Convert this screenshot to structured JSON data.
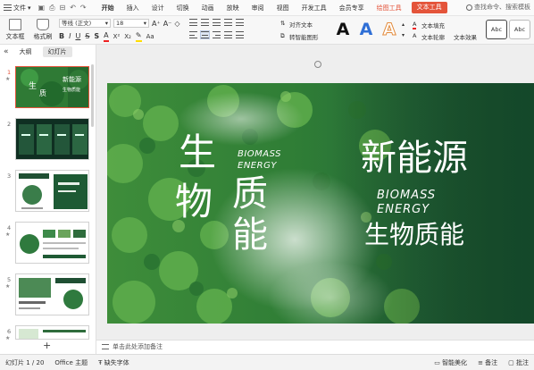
{
  "menubar": {
    "file": "文件",
    "tabs": [
      "开始",
      "插入",
      "设计",
      "切换",
      "动画",
      "放映",
      "审阅",
      "视图",
      "开发工具",
      "会员专享"
    ],
    "context_tabs": [
      "绘图工具",
      "文本工具"
    ],
    "search": "查找命令、搜索模板"
  },
  "ribbon": {
    "textbox": "文本框",
    "format_painter": "格式刷",
    "font_name": "等线 (正文)",
    "font_size": "18",
    "align_text": "对齐文本",
    "convert_smartart": "转智能图形",
    "text_fill": "文本填充",
    "text_outline": "文本轮廓",
    "text_effect": "文本效果",
    "style_label": "Abc"
  },
  "left_panel": {
    "tab_outline": "大纲",
    "tab_slides": "幻灯片",
    "numbers": [
      "1",
      "2",
      "3",
      "4",
      "5",
      "6"
    ]
  },
  "slide": {
    "big_chars": [
      "生",
      "物",
      "质",
      "能"
    ],
    "biomass_small": "BIOMASS",
    "energy_small": "ENERGY",
    "title_cn": "新能源",
    "biomass_right": "BIOMASS",
    "energy_right": "ENERGY",
    "subtitle_cn": "生物质能"
  },
  "notes": {
    "placeholder": "单击此处添加备注"
  },
  "statusbar": {
    "slide_count": "幻灯片 1 / 20",
    "theme": "Office 主题",
    "missing_font": "缺失字体",
    "smart_beautify": "智能美化",
    "notes": "备注",
    "comments": "批注"
  }
}
